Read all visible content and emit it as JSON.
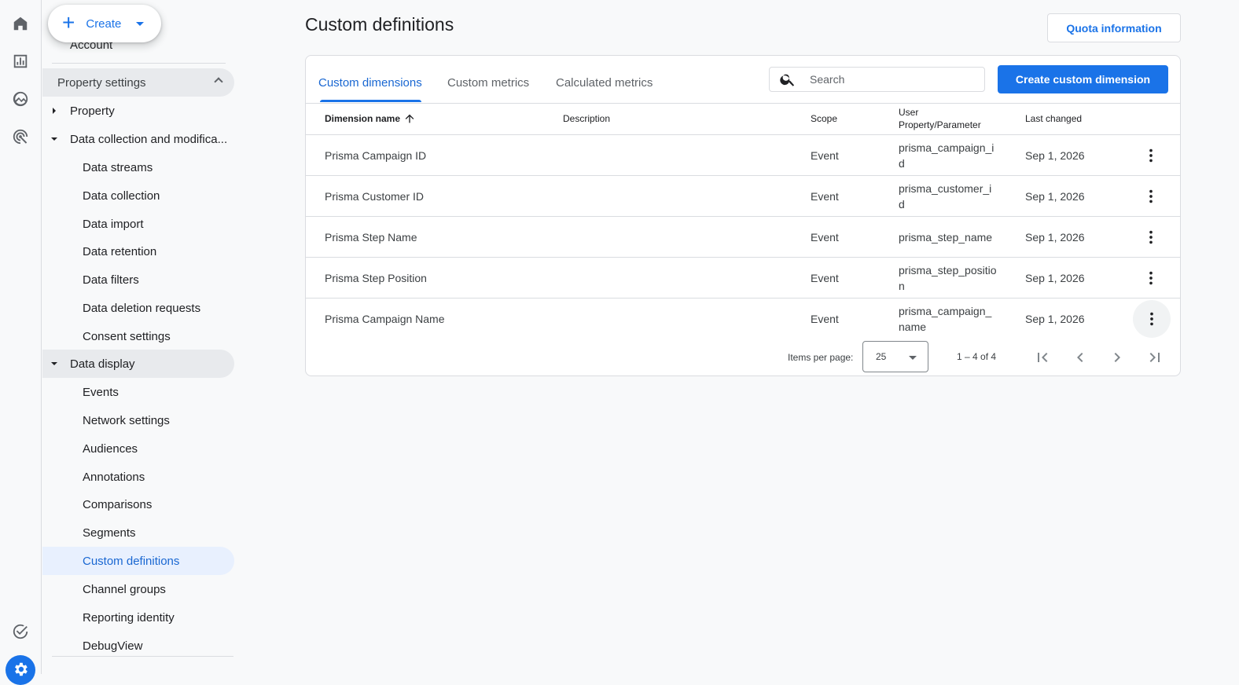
{
  "rail": {
    "icons": [
      "home-icon",
      "reports-icon",
      "explore-icon",
      "advertising-icon",
      "insights-icon",
      "admin-gear-icon"
    ]
  },
  "sidebar": {
    "create_label": "Create",
    "account_peek": "Account",
    "property_settings": "Property settings",
    "property": "Property",
    "data_collection_group": "Data collection and modifica...",
    "data_collection_items": [
      "Data streams",
      "Data collection",
      "Data import",
      "Data retention",
      "Data filters",
      "Data deletion requests",
      "Consent settings"
    ],
    "data_display_group": "Data display",
    "data_display_items": [
      "Events",
      "Network settings",
      "Audiences",
      "Annotations",
      "Comparisons",
      "Segments",
      "Custom definitions",
      "Channel groups",
      "Reporting identity",
      "DebugView"
    ],
    "active_item": "Custom definitions"
  },
  "page": {
    "title": "Custom definitions",
    "quota_button": "Quota information"
  },
  "tabs": [
    {
      "label": "Custom dimensions",
      "selected": true
    },
    {
      "label": "Custom metrics",
      "selected": false
    },
    {
      "label": "Calculated metrics",
      "selected": false
    }
  ],
  "search": {
    "placeholder": "Search",
    "value": ""
  },
  "create_button": "Create custom dimension",
  "table": {
    "columns": {
      "name": "Dimension name",
      "description": "Description",
      "scope": "Scope",
      "param_line1": "User",
      "param_line2": "Property/Parameter",
      "last_changed": "Last changed"
    },
    "rows": [
      {
        "name": "Prisma Campaign ID",
        "description": "",
        "scope": "Event",
        "param": "prisma_campaign_id",
        "last_changed": "Sep 1, 2026"
      },
      {
        "name": "Prisma Customer ID",
        "description": "",
        "scope": "Event",
        "param": "prisma_customer_id",
        "last_changed": "Sep 1, 2026"
      },
      {
        "name": "Prisma Step Name",
        "description": "",
        "scope": "Event",
        "param": "prisma_step_name",
        "last_changed": "Sep 1, 2026"
      },
      {
        "name": "Prisma Step Position",
        "description": "",
        "scope": "Event",
        "param": "prisma_step_position",
        "last_changed": "Sep 1, 2026"
      },
      {
        "name": "Prisma Campaign Name",
        "description": "",
        "scope": "Event",
        "param": "prisma_campaign_name",
        "last_changed": "Sep 1, 2026"
      }
    ]
  },
  "pager": {
    "items_per_page_label": "Items per page:",
    "items_per_page": "25",
    "range": "1 – 4 of 4"
  },
  "colors": {
    "accent": "#1a73e8",
    "active_bg": "#e8f0fe",
    "border": "#dadce0"
  }
}
